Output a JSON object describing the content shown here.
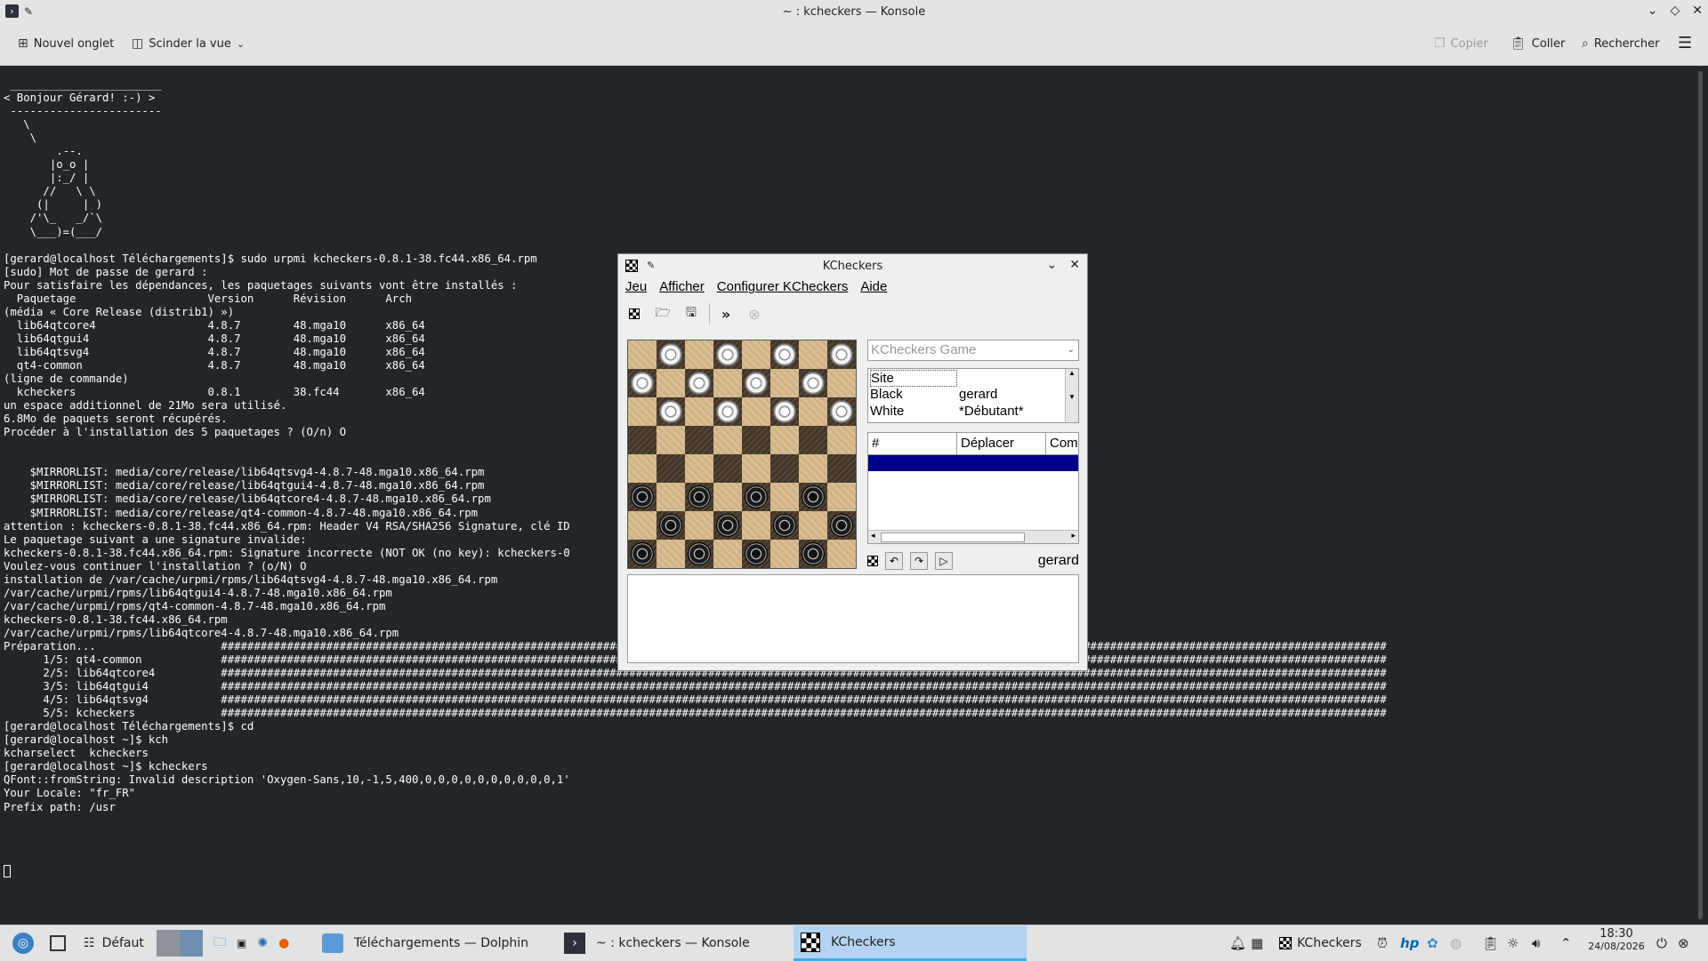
{
  "konsole": {
    "title": "~ : kcheckers — Konsole",
    "toolbar": {
      "new_tab": "Nouvel onglet",
      "split_view": "Scinder la vue",
      "copy": "Copier",
      "paste": "Coller",
      "search": "Rechercher"
    },
    "terminal_text": " _______________________\n< Bonjour Gérard! :-) >\n -----------------------\n   \\\n    \\\n        .--.\n       |o_o |\n       |:_/ |\n      //   \\ \\\n     (|     | )\n    /'\\_   _/`\\\n    \\___)=(___/\n\n[gerard@localhost Téléchargements]$ sudo urpmi kcheckers-0.8.1-38.fc44.x86_64.rpm\n[sudo] Mot de passe de gerard :\nPour satisfaire les dépendances, les paquetages suivants vont être installés :\n  Paquetage                    Version      Révision      Arch\n(média « Core Release (distrib1) »)\n  lib64qtcore4                 4.8.7        48.mga10      x86_64\n  lib64qtgui4                  4.8.7        48.mga10      x86_64\n  lib64qtsvg4                  4.8.7        48.mga10      x86_64\n  qt4-common                   4.8.7        48.mga10      x86_64\n(ligne de commande)\n  kcheckers                    0.8.1        38.fc44       x86_64\nun espace additionnel de 21Mo sera utilisé.\n6.8Mo de paquets seront récupérés.\nProcéder à l'installation des 5 paquetages ? (O/n) O\n\n\n    $MIRRORLIST: media/core/release/lib64qtsvg4-4.8.7-48.mga10.x86_64.rpm\n    $MIRRORLIST: media/core/release/lib64qtgui4-4.8.7-48.mga10.x86_64.rpm\n    $MIRRORLIST: media/core/release/lib64qtcore4-4.8.7-48.mga10.x86_64.rpm\n    $MIRRORLIST: media/core/release/qt4-common-4.8.7-48.mga10.x86_64.rpm\nattention : kcheckers-0.8.1-38.fc44.x86_64.rpm: Header V4 RSA/SHA256 Signature, clé ID\nLe paquetage suivant a une signature invalide:\nkcheckers-0.8.1-38.fc44.x86_64.rpm: Signature incorrecte (NOT OK (no key): kcheckers-0                                                            0f90a6: NOKEY)\nVoulez-vous continuer l'installation ? (o/N) O\ninstallation de /var/cache/urpmi/rpms/lib64qtsvg4-4.8.7-48.mga10.x86_64.rpm\n/var/cache/urpmi/rpms/lib64qtgui4-4.8.7-48.mga10.x86_64.rpm\n/var/cache/urpmi/rpms/qt4-common-4.8.7-48.mga10.x86_64.rpm\nkcheckers-0.8.1-38.fc44.x86_64.rpm\n/var/cache/urpmi/rpms/lib64qtcore4-4.8.7-48.mga10.x86_64.rpm\nPréparation...                   #################################################################################################################################################################################\n      1/5: qt4-common            #################################################################################################################################################################################\n      2/5: lib64qtcore4          #################################################################################################################################################################################\n      3/5: lib64qtgui4           #################################################################################################################################################################################\n      4/5: lib64qtsvg4           #################################################################################################################################################################################\n      5/5: kcheckers             #################################################################################################################################################################################\n[gerard@localhost Téléchargements]$ cd\n[gerard@localhost ~]$ kch\nkcharselect  kcheckers\n[gerard@localhost ~]$ kcheckers\nQFont::fromString: Invalid description 'Oxygen-Sans,10,-1,5,400,0,0,0,0,0,0,0,0,0,0,1'\nYour Locale: \"fr_FR\"\nPrefix path: /usr"
  },
  "kcheckers": {
    "title": "KCheckers",
    "menu": [
      "Jeu",
      "Afficher",
      "Configurer KCheckers",
      "Aide"
    ],
    "game_combo": "KCheckers Game",
    "info": {
      "site_label": "Site",
      "black_label": "Black",
      "black_value": "gerard",
      "white_label": "White",
      "white_value": "*Débutant*"
    },
    "moves_headers": [
      "#",
      "Déplacer",
      "Com"
    ],
    "player": "gerard",
    "board": [
      [
        "",
        "w",
        "",
        "w",
        "",
        "w",
        "",
        "w"
      ],
      [
        "w",
        "",
        "w",
        "",
        "w",
        "",
        "w",
        ""
      ],
      [
        "",
        "w",
        "",
        "w",
        "",
        "w",
        "",
        "w"
      ],
      [
        "",
        "",
        "",
        "",
        "",
        "",
        "",
        ""
      ],
      [
        "",
        "",
        "",
        "",
        "",
        "",
        "",
        ""
      ],
      [
        "b",
        "",
        "b",
        "",
        "b",
        "",
        "b",
        ""
      ],
      [
        "",
        "b",
        "",
        "b",
        "",
        "b",
        "",
        "b"
      ],
      [
        "b",
        "",
        "b",
        "",
        "b",
        "",
        "b",
        ""
      ]
    ]
  },
  "taskbar": {
    "desktop": "Défaut",
    "tasks": [
      {
        "label": "Téléchargements — Dolphin",
        "icon": "dolphin-icon"
      },
      {
        "label": "~ : kcheckers — Konsole",
        "icon": "konsole-icon"
      },
      {
        "label": "KCheckers",
        "icon": "kcheckers-icon"
      }
    ],
    "tray_kcheckers": "KCheckers",
    "time": "18:30",
    "date": "24/08/2026"
  }
}
